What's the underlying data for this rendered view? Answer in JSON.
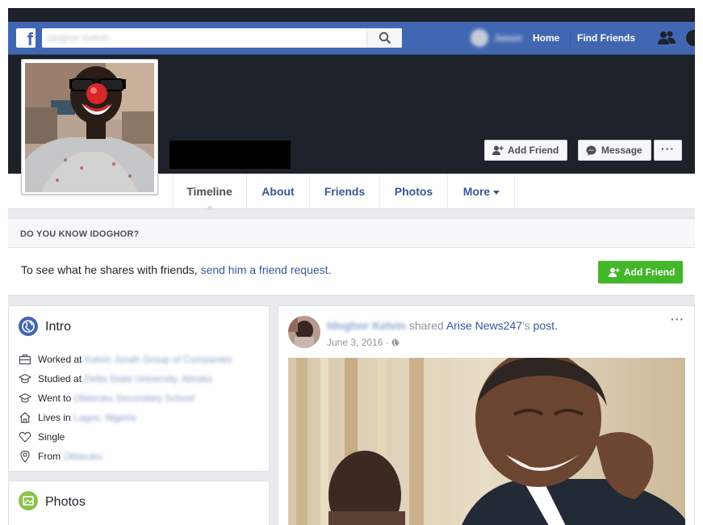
{
  "topnav": {
    "logo": "f",
    "search_value": "Idoghor Kelvin",
    "username": "Jason",
    "home_label": "Home",
    "find_friends_label": "Find Friends"
  },
  "cover": {
    "add_friend_label": "Add Friend",
    "message_label": "Message",
    "more_label": "···"
  },
  "tabs": [
    {
      "label": "Timeline"
    },
    {
      "label": "About"
    },
    {
      "label": "Friends"
    },
    {
      "label": "Photos"
    },
    {
      "label": "More"
    }
  ],
  "know": {
    "title": "DO YOU KNOW IDOGHOR?",
    "text": "To see what he shares with friends, ",
    "link": "send him a friend request.",
    "button": "Add Friend"
  },
  "intro": {
    "title": "Intro",
    "rows": [
      {
        "prefix": "Worked at",
        "value": "Kelvin Jonah Group of Companies",
        "icon": "briefcase-icon"
      },
      {
        "prefix": "Studied at",
        "value": "Delta State University, Abraka",
        "icon": "graduation-cap-icon"
      },
      {
        "prefix": "Went to",
        "value": "Obiaruku Secondary School",
        "icon": "graduation-cap-icon"
      },
      {
        "prefix": "Lives in",
        "value": "Lagos, Nigeria",
        "icon": "home-icon"
      },
      {
        "prefix": "Single",
        "value": "",
        "icon": "heart-icon"
      },
      {
        "prefix": "From",
        "value": "Obiaruku",
        "icon": "location-pin-icon"
      }
    ]
  },
  "photos_card": {
    "title": "Photos"
  },
  "post": {
    "author": "Idoghor Kelvin",
    "shared_text": " shared ",
    "page_link": "Arise News247",
    "possessive": "'s ",
    "post_link": "post.",
    "date": "June 3, 2016",
    "date_sep": " · ",
    "more_label": "···"
  },
  "colors": {
    "brand_blue": "#4267b2",
    "dark_cover": "#1d2129",
    "link": "#365899",
    "green": "#42b72a"
  }
}
